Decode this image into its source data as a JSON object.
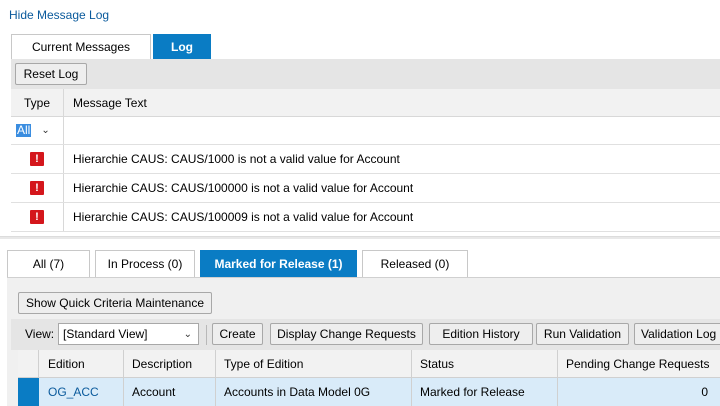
{
  "message_log": {
    "hide_link": "Hide Message Log",
    "tabs": [
      {
        "label": "Current Messages",
        "active": false
      },
      {
        "label": "Log",
        "active": true
      }
    ],
    "reset_button": "Reset Log",
    "columns": {
      "type": "Type",
      "text": "Message Text"
    },
    "filter_value": "All",
    "messages": [
      {
        "type": "error",
        "text": "Hierarchie CAUS: CAUS/1000 is not a valid value for Account"
      },
      {
        "type": "error",
        "text": "Hierarchie CAUS: CAUS/100000 is not a valid value for Account"
      },
      {
        "type": "error",
        "text": "Hierarchie CAUS: CAUS/100009 is not a valid value for Account"
      }
    ],
    "error_icon_glyph": "!"
  },
  "status_tabs": [
    {
      "label": "All (7)",
      "active": false
    },
    {
      "label": "In Process (0)",
      "active": false
    },
    {
      "label": "Marked for Release (1)",
      "active": true
    },
    {
      "label": "Released (0)",
      "active": false
    }
  ],
  "criteria_button": "Show Quick Criteria Maintenance",
  "toolbar": {
    "view_label": "View:",
    "view_value": "[Standard View]",
    "buttons": {
      "create": "Create",
      "display_cr": "Display Change Requests",
      "edition_history": "Edition History",
      "run_validation": "Run Validation",
      "validation_log": "Validation Log"
    }
  },
  "grid": {
    "columns": [
      "Edition",
      "Description",
      "Type of Edition",
      "Status",
      "Pending Change Requests"
    ],
    "rows": [
      {
        "edition": "OG_ACC",
        "description": "Account",
        "type": "Accounts in Data Model 0G",
        "status": "Marked for Release",
        "pending": "0"
      }
    ]
  },
  "colors": {
    "accent": "#0a7cc4",
    "error": "#d4161c",
    "link": "#0a5a9c"
  }
}
